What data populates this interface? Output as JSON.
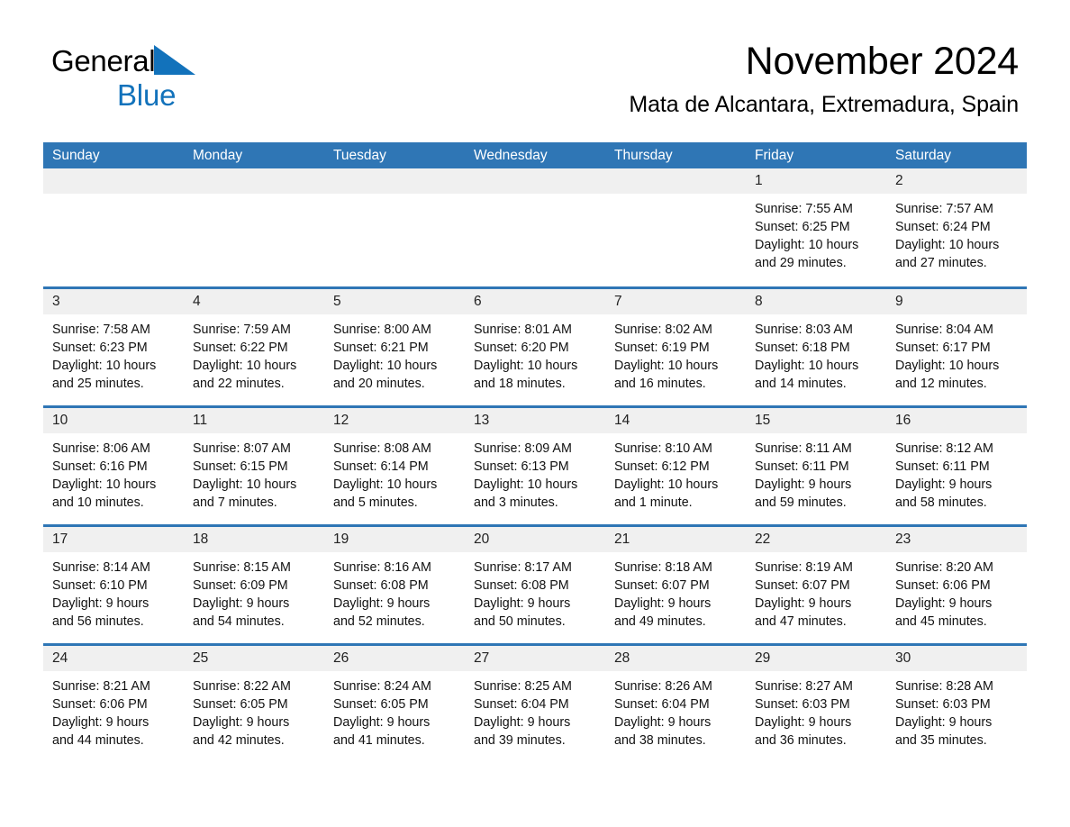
{
  "brand": {
    "name_part1": "General",
    "name_part2": "Blue",
    "triangle_color": "#1272bb"
  },
  "header": {
    "month_title": "November 2024",
    "location": "Mata de Alcantara, Extremadura, Spain"
  },
  "theme": {
    "header_blue": "#2f76b5",
    "date_band_gray": "#f0f0f0",
    "text_black": "#000000"
  },
  "calendar": {
    "weekdays": [
      "Sunday",
      "Monday",
      "Tuesday",
      "Wednesday",
      "Thursday",
      "Friday",
      "Saturday"
    ],
    "weeks": [
      [
        {
          "day": "",
          "empty": true
        },
        {
          "day": "",
          "empty": true
        },
        {
          "day": "",
          "empty": true
        },
        {
          "day": "",
          "empty": true
        },
        {
          "day": "",
          "empty": true
        },
        {
          "day": "1",
          "sunrise": "Sunrise: 7:55 AM",
          "sunset": "Sunset: 6:25 PM",
          "daylight1": "Daylight: 10 hours",
          "daylight2": "and 29 minutes."
        },
        {
          "day": "2",
          "sunrise": "Sunrise: 7:57 AM",
          "sunset": "Sunset: 6:24 PM",
          "daylight1": "Daylight: 10 hours",
          "daylight2": "and 27 minutes."
        }
      ],
      [
        {
          "day": "3",
          "sunrise": "Sunrise: 7:58 AM",
          "sunset": "Sunset: 6:23 PM",
          "daylight1": "Daylight: 10 hours",
          "daylight2": "and 25 minutes."
        },
        {
          "day": "4",
          "sunrise": "Sunrise: 7:59 AM",
          "sunset": "Sunset: 6:22 PM",
          "daylight1": "Daylight: 10 hours",
          "daylight2": "and 22 minutes."
        },
        {
          "day": "5",
          "sunrise": "Sunrise: 8:00 AM",
          "sunset": "Sunset: 6:21 PM",
          "daylight1": "Daylight: 10 hours",
          "daylight2": "and 20 minutes."
        },
        {
          "day": "6",
          "sunrise": "Sunrise: 8:01 AM",
          "sunset": "Sunset: 6:20 PM",
          "daylight1": "Daylight: 10 hours",
          "daylight2": "and 18 minutes."
        },
        {
          "day": "7",
          "sunrise": "Sunrise: 8:02 AM",
          "sunset": "Sunset: 6:19 PM",
          "daylight1": "Daylight: 10 hours",
          "daylight2": "and 16 minutes."
        },
        {
          "day": "8",
          "sunrise": "Sunrise: 8:03 AM",
          "sunset": "Sunset: 6:18 PM",
          "daylight1": "Daylight: 10 hours",
          "daylight2": "and 14 minutes."
        },
        {
          "day": "9",
          "sunrise": "Sunrise: 8:04 AM",
          "sunset": "Sunset: 6:17 PM",
          "daylight1": "Daylight: 10 hours",
          "daylight2": "and 12 minutes."
        }
      ],
      [
        {
          "day": "10",
          "sunrise": "Sunrise: 8:06 AM",
          "sunset": "Sunset: 6:16 PM",
          "daylight1": "Daylight: 10 hours",
          "daylight2": "and 10 minutes."
        },
        {
          "day": "11",
          "sunrise": "Sunrise: 8:07 AM",
          "sunset": "Sunset: 6:15 PM",
          "daylight1": "Daylight: 10 hours",
          "daylight2": "and 7 minutes."
        },
        {
          "day": "12",
          "sunrise": "Sunrise: 8:08 AM",
          "sunset": "Sunset: 6:14 PM",
          "daylight1": "Daylight: 10 hours",
          "daylight2": "and 5 minutes."
        },
        {
          "day": "13",
          "sunrise": "Sunrise: 8:09 AM",
          "sunset": "Sunset: 6:13 PM",
          "daylight1": "Daylight: 10 hours",
          "daylight2": "and 3 minutes."
        },
        {
          "day": "14",
          "sunrise": "Sunrise: 8:10 AM",
          "sunset": "Sunset: 6:12 PM",
          "daylight1": "Daylight: 10 hours",
          "daylight2": "and 1 minute."
        },
        {
          "day": "15",
          "sunrise": "Sunrise: 8:11 AM",
          "sunset": "Sunset: 6:11 PM",
          "daylight1": "Daylight: 9 hours",
          "daylight2": "and 59 minutes."
        },
        {
          "day": "16",
          "sunrise": "Sunrise: 8:12 AM",
          "sunset": "Sunset: 6:11 PM",
          "daylight1": "Daylight: 9 hours",
          "daylight2": "and 58 minutes."
        }
      ],
      [
        {
          "day": "17",
          "sunrise": "Sunrise: 8:14 AM",
          "sunset": "Sunset: 6:10 PM",
          "daylight1": "Daylight: 9 hours",
          "daylight2": "and 56 minutes."
        },
        {
          "day": "18",
          "sunrise": "Sunrise: 8:15 AM",
          "sunset": "Sunset: 6:09 PM",
          "daylight1": "Daylight: 9 hours",
          "daylight2": "and 54 minutes."
        },
        {
          "day": "19",
          "sunrise": "Sunrise: 8:16 AM",
          "sunset": "Sunset: 6:08 PM",
          "daylight1": "Daylight: 9 hours",
          "daylight2": "and 52 minutes."
        },
        {
          "day": "20",
          "sunrise": "Sunrise: 8:17 AM",
          "sunset": "Sunset: 6:08 PM",
          "daylight1": "Daylight: 9 hours",
          "daylight2": "and 50 minutes."
        },
        {
          "day": "21",
          "sunrise": "Sunrise: 8:18 AM",
          "sunset": "Sunset: 6:07 PM",
          "daylight1": "Daylight: 9 hours",
          "daylight2": "and 49 minutes."
        },
        {
          "day": "22",
          "sunrise": "Sunrise: 8:19 AM",
          "sunset": "Sunset: 6:07 PM",
          "daylight1": "Daylight: 9 hours",
          "daylight2": "and 47 minutes."
        },
        {
          "day": "23",
          "sunrise": "Sunrise: 8:20 AM",
          "sunset": "Sunset: 6:06 PM",
          "daylight1": "Daylight: 9 hours",
          "daylight2": "and 45 minutes."
        }
      ],
      [
        {
          "day": "24",
          "sunrise": "Sunrise: 8:21 AM",
          "sunset": "Sunset: 6:06 PM",
          "daylight1": "Daylight: 9 hours",
          "daylight2": "and 44 minutes."
        },
        {
          "day": "25",
          "sunrise": "Sunrise: 8:22 AM",
          "sunset": "Sunset: 6:05 PM",
          "daylight1": "Daylight: 9 hours",
          "daylight2": "and 42 minutes."
        },
        {
          "day": "26",
          "sunrise": "Sunrise: 8:24 AM",
          "sunset": "Sunset: 6:05 PM",
          "daylight1": "Daylight: 9 hours",
          "daylight2": "and 41 minutes."
        },
        {
          "day": "27",
          "sunrise": "Sunrise: 8:25 AM",
          "sunset": "Sunset: 6:04 PM",
          "daylight1": "Daylight: 9 hours",
          "daylight2": "and 39 minutes."
        },
        {
          "day": "28",
          "sunrise": "Sunrise: 8:26 AM",
          "sunset": "Sunset: 6:04 PM",
          "daylight1": "Daylight: 9 hours",
          "daylight2": "and 38 minutes."
        },
        {
          "day": "29",
          "sunrise": "Sunrise: 8:27 AM",
          "sunset": "Sunset: 6:03 PM",
          "daylight1": "Daylight: 9 hours",
          "daylight2": "and 36 minutes."
        },
        {
          "day": "30",
          "sunrise": "Sunrise: 8:28 AM",
          "sunset": "Sunset: 6:03 PM",
          "daylight1": "Daylight: 9 hours",
          "daylight2": "and 35 minutes."
        }
      ]
    ]
  }
}
